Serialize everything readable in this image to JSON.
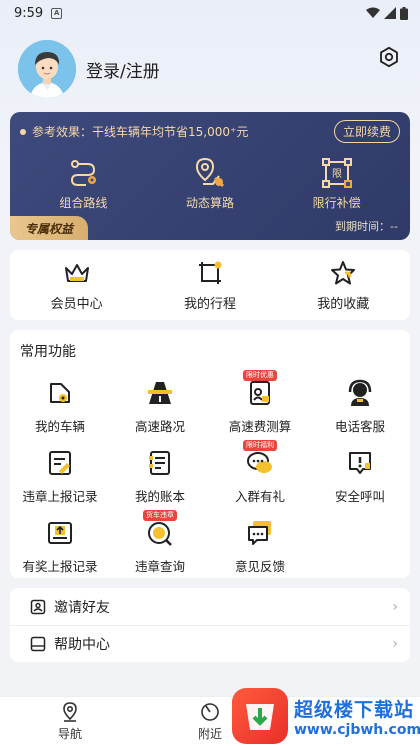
{
  "status_bar": {
    "time": "9:59",
    "notification_icon": "A"
  },
  "profile": {
    "login_label": "登录/注册"
  },
  "vip_card": {
    "effect_text": "参考效果：干线车辆年均节省15,000⁺元",
    "renew_label": "立即续费",
    "features": [
      {
        "icon": "combined-route-icon",
        "label": "组合路线"
      },
      {
        "icon": "dynamic-route-icon",
        "label": "动态算路"
      },
      {
        "icon": "restriction-compensation-icon",
        "label": "限行补偿"
      }
    ],
    "exclusive_label": "专属权益",
    "expiry_label": "到期时间：--"
  },
  "quick_items": [
    {
      "icon": "crown-icon",
      "label": "会员中心"
    },
    {
      "icon": "trip-icon",
      "label": "我的行程"
    },
    {
      "icon": "star-icon",
      "label": "我的收藏"
    }
  ],
  "functions": {
    "title": "常用功能",
    "items": [
      {
        "icon": "my-vehicle-icon",
        "label": "我的车辆",
        "badge": ""
      },
      {
        "icon": "highway-icon",
        "label": "高速路况",
        "badge": ""
      },
      {
        "icon": "toll-calc-icon",
        "label": "高速费测算",
        "badge": "限时优惠"
      },
      {
        "icon": "customer-service-icon",
        "label": "电话客服",
        "badge": ""
      },
      {
        "icon": "violation-report-icon",
        "label": "违章上报记录",
        "badge": ""
      },
      {
        "icon": "ledger-icon",
        "label": "我的账本",
        "badge": ""
      },
      {
        "icon": "group-chat-icon",
        "label": "入群有礼",
        "badge": "限时福利"
      },
      {
        "icon": "safety-call-icon",
        "label": "安全呼叫",
        "badge": ""
      },
      {
        "icon": "reward-report-icon",
        "label": "有奖上报记录",
        "badge": ""
      },
      {
        "icon": "violation-query-icon",
        "label": "违章查询",
        "badge": "货车违章"
      },
      {
        "icon": "feedback-icon",
        "label": "意见反馈",
        "badge": ""
      }
    ]
  },
  "list": [
    {
      "icon": "invite-icon",
      "label": "邀请好友"
    },
    {
      "icon": "help-icon",
      "label": "帮助中心"
    }
  ],
  "tabs": [
    {
      "icon": "navigation-icon",
      "label": "导航"
    },
    {
      "icon": "nearby-icon",
      "label": "附近"
    }
  ],
  "watermark": {
    "title": "超级楼下载站",
    "url": "www.cjbwh.com"
  },
  "colors": {
    "vip_bg": "#2f3a68",
    "gold": "#f6d9a6",
    "accent_yellow": "#f5c02d",
    "badge_red": "#e8453c"
  }
}
